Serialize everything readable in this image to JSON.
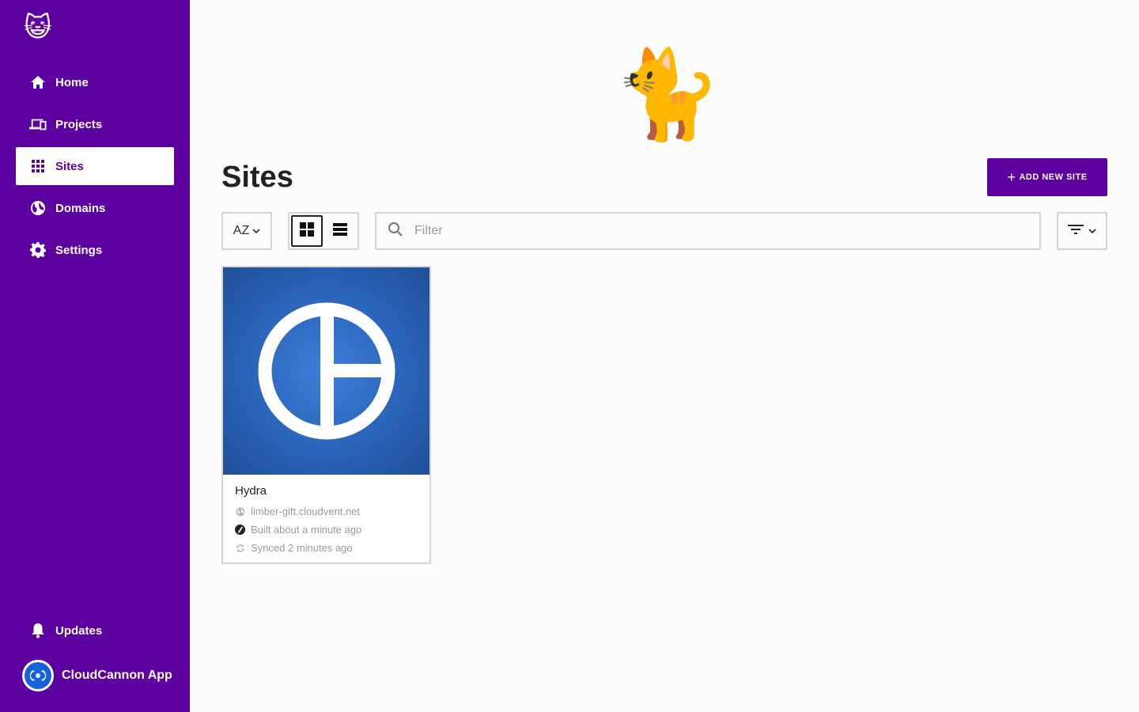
{
  "sidebar": {
    "logo_emoji": "😺",
    "items": [
      {
        "label": "Home",
        "icon": "home-icon"
      },
      {
        "label": "Projects",
        "icon": "devices-icon"
      },
      {
        "label": "Sites",
        "icon": "grid-icon",
        "active": true
      },
      {
        "label": "Domains",
        "icon": "globe-icon"
      },
      {
        "label": "Settings",
        "icon": "gear-icon"
      }
    ],
    "updates_label": "Updates",
    "app_label": "CloudCannon App"
  },
  "main": {
    "hero_emoji": "🐈",
    "title": "Sites",
    "add_button_label": "ADD NEW SITE",
    "sort_label": "AZ",
    "filter_placeholder": "Filter",
    "filter_value": "",
    "view_mode": "grid"
  },
  "sites": [
    {
      "name": "Hydra",
      "domain": "limber-gift.cloudvent.net",
      "built": "Built about a minute ago",
      "synced": "Synced 2 minutes ago"
    }
  ],
  "colors": {
    "brand": "#5c00a0",
    "thumb_blue": "#2a63b8"
  }
}
